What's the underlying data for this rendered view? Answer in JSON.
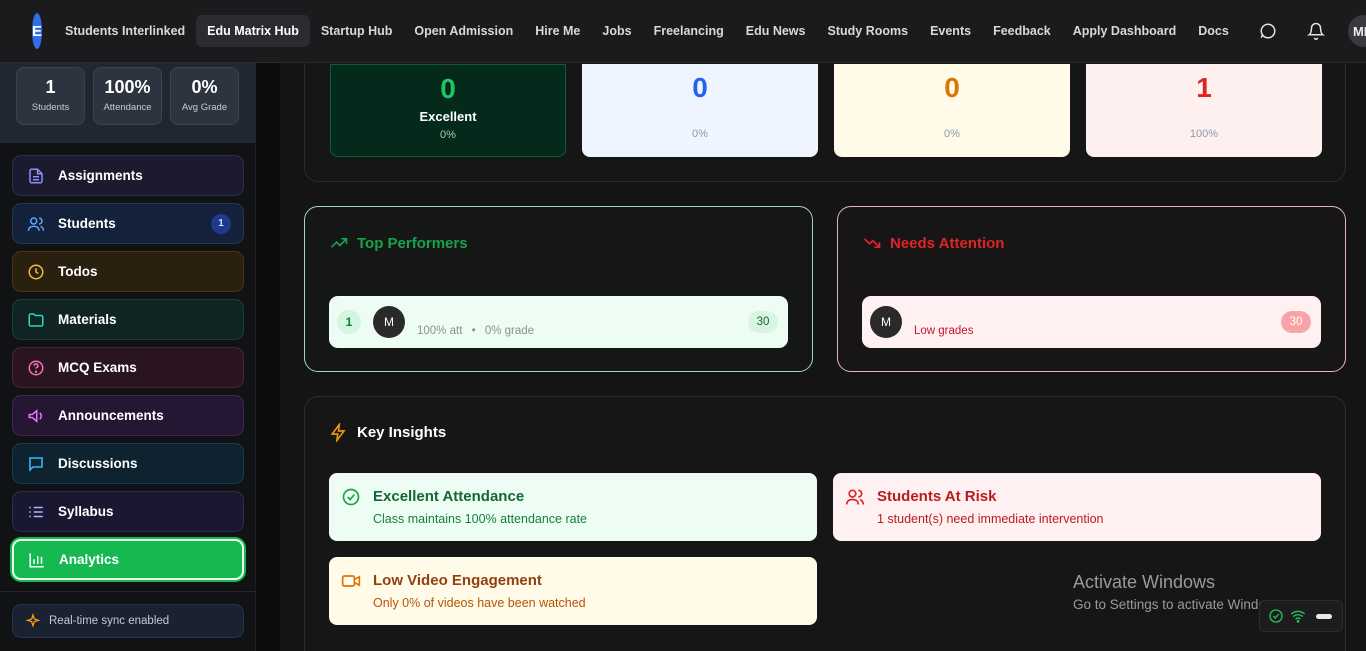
{
  "nav": {
    "logo_text": "E",
    "items": [
      "Students Interlinked",
      "Edu Matrix Hub",
      "Startup Hub",
      "Open Admission",
      "Hire Me",
      "Jobs",
      "Freelancing",
      "Edu News",
      "Study Rooms",
      "Events",
      "Feedback",
      "Apply Dashboard",
      "Docs"
    ],
    "active": "Edu Matrix Hub",
    "icons": [
      "message-icon",
      "bell-icon"
    ],
    "avatar": "MM"
  },
  "sidebar": {
    "stats": [
      {
        "value": "1",
        "label": "Students"
      },
      {
        "value": "100%",
        "label": "Attendance"
      },
      {
        "value": "0%",
        "label": "Avg Grade"
      }
    ],
    "items": [
      {
        "label": "Assignments",
        "icon": "document-icon"
      },
      {
        "label": "Students",
        "icon": "users-icon",
        "badge": "1"
      },
      {
        "label": "Todos",
        "icon": "clock-icon"
      },
      {
        "label": "Materials",
        "icon": "folder-icon"
      },
      {
        "label": "MCQ Exams",
        "icon": "question-icon"
      },
      {
        "label": "Announcements",
        "icon": "megaphone-icon"
      },
      {
        "label": "Discussions",
        "icon": "chat-icon"
      },
      {
        "label": "Syllabus",
        "icon": "list-icon"
      },
      {
        "label": "Analytics",
        "icon": "bar-chart-icon",
        "active": true
      }
    ],
    "sync_text": "Real-time sync enabled"
  },
  "grade_cards": [
    {
      "value": "0",
      "label": "Excellent",
      "percent": "0%",
      "color": "#22c55e"
    },
    {
      "value": "0",
      "label": "",
      "percent": "0%",
      "color": "#2563eb"
    },
    {
      "value": "0",
      "label": "",
      "percent": "0%",
      "color": "#d97706"
    },
    {
      "value": "1",
      "label": "",
      "percent": "100%",
      "color": "#dc2626"
    }
  ],
  "top_performers": {
    "title": "Top Performers",
    "rank": "1",
    "avatar": "M",
    "attendance": "100% att",
    "separator": "•",
    "grade": "0% grade",
    "score": "30"
  },
  "needs_attention": {
    "title": "Needs Attention",
    "avatar": "M",
    "reason": "Low grades",
    "score": "30"
  },
  "insights": {
    "title": "Key Insights",
    "cards": [
      {
        "heading": "Excellent Attendance",
        "text": "Class maintains 100% attendance rate",
        "icon": "check-circle-icon"
      },
      {
        "heading": "Students At Risk",
        "text": "1 student(s) need immediate intervention",
        "icon": "users-icon"
      },
      {
        "heading": "Low Video Engagement",
        "text": "Only 0% of videos have been watched",
        "icon": "video-icon"
      }
    ]
  },
  "watermark": {
    "line1": "Activate Windows",
    "line2": "Go to Settings to activate Windows."
  }
}
